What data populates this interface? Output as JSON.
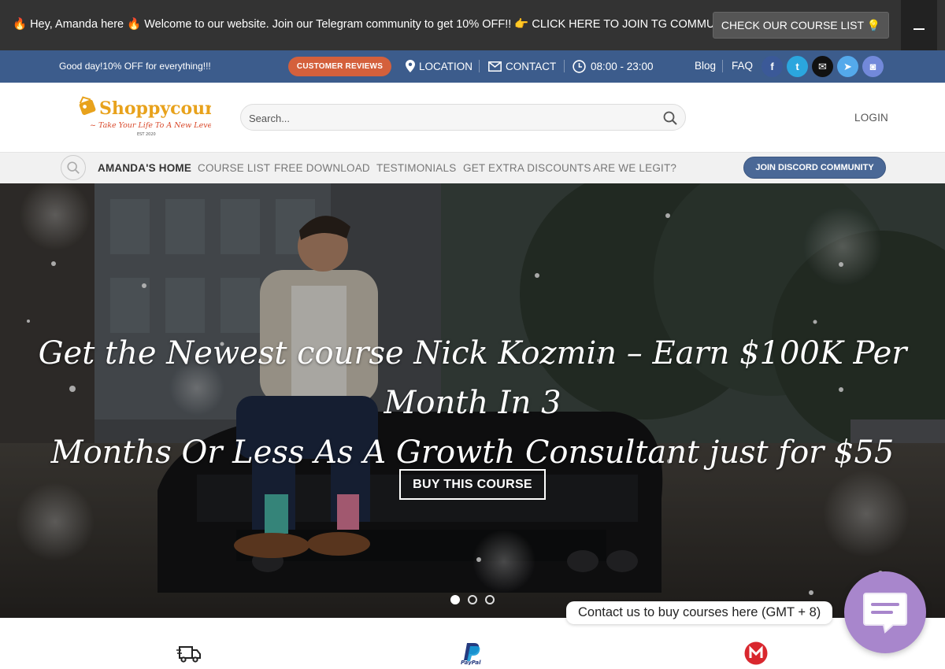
{
  "notice_bar": {
    "message": "🔥 Hey, Amanda here 🔥 Welcome to our website. Join our Telegram community to get 10% OFF!! 👉 CLICK HERE TO JOIN TG COMMUNITY 👈",
    "course_list_button": "CHECK OUR COURSE LIST 💡",
    "close_icon": "minus-icon"
  },
  "top_bar": {
    "greeting": "Good day!10% OFF for everything!!!",
    "reviews_button": "CUSTOMER REVIEWS",
    "location": "LOCATION",
    "contact": "CONTACT",
    "hours": "08:00 - 23:00",
    "blog": "Blog",
    "faq": "FAQ",
    "social": [
      {
        "name": "facebook",
        "glyph": "f",
        "color": "#3b5998"
      },
      {
        "name": "twitter",
        "glyph": "t",
        "color": "#2ba6de"
      },
      {
        "name": "email",
        "glyph": "✉",
        "color": "#111111"
      },
      {
        "name": "telegram",
        "glyph": "➤",
        "color": "#54a9eb"
      },
      {
        "name": "discord",
        "glyph": "◙",
        "color": "#7289da"
      }
    ]
  },
  "header": {
    "logo_text": "Shoppycourses",
    "logo_tagline": "~ Take Your Life To A New Level ~",
    "logo_est": "EST 2020",
    "search_placeholder": "Search...",
    "login": "LOGIN"
  },
  "nav": {
    "items": [
      {
        "label": "AMANDA'S HOME",
        "active": true
      },
      {
        "label": "COURSE LIST",
        "active": false
      },
      {
        "label": "FREE DOWNLOAD",
        "active": false
      },
      {
        "label": "TESTIMONIALS",
        "active": false
      },
      {
        "label": "GET EXTRA DISCOUNTS",
        "active": false
      },
      {
        "label": "ARE WE LEGIT?",
        "active": false
      }
    ],
    "discord_button": "JOIN DISCORD COMMUNITY"
  },
  "hero": {
    "title_line1": "Get the Newest course Nick Kozmin – Earn $100K Per Month In 3",
    "title_line2": "Months Or Less As A Growth Consultant just for $55",
    "button": "BUY THIS COURSE",
    "slides": 3,
    "active_slide": 1
  },
  "features": {
    "icons": [
      "delivery-truck-icon",
      "paypal-icon",
      "mega-icon"
    ]
  },
  "chat": {
    "label": "Contact us to buy courses here (GMT + 8)",
    "icon": "chat-bubble-icon",
    "color": "#a886cc"
  }
}
